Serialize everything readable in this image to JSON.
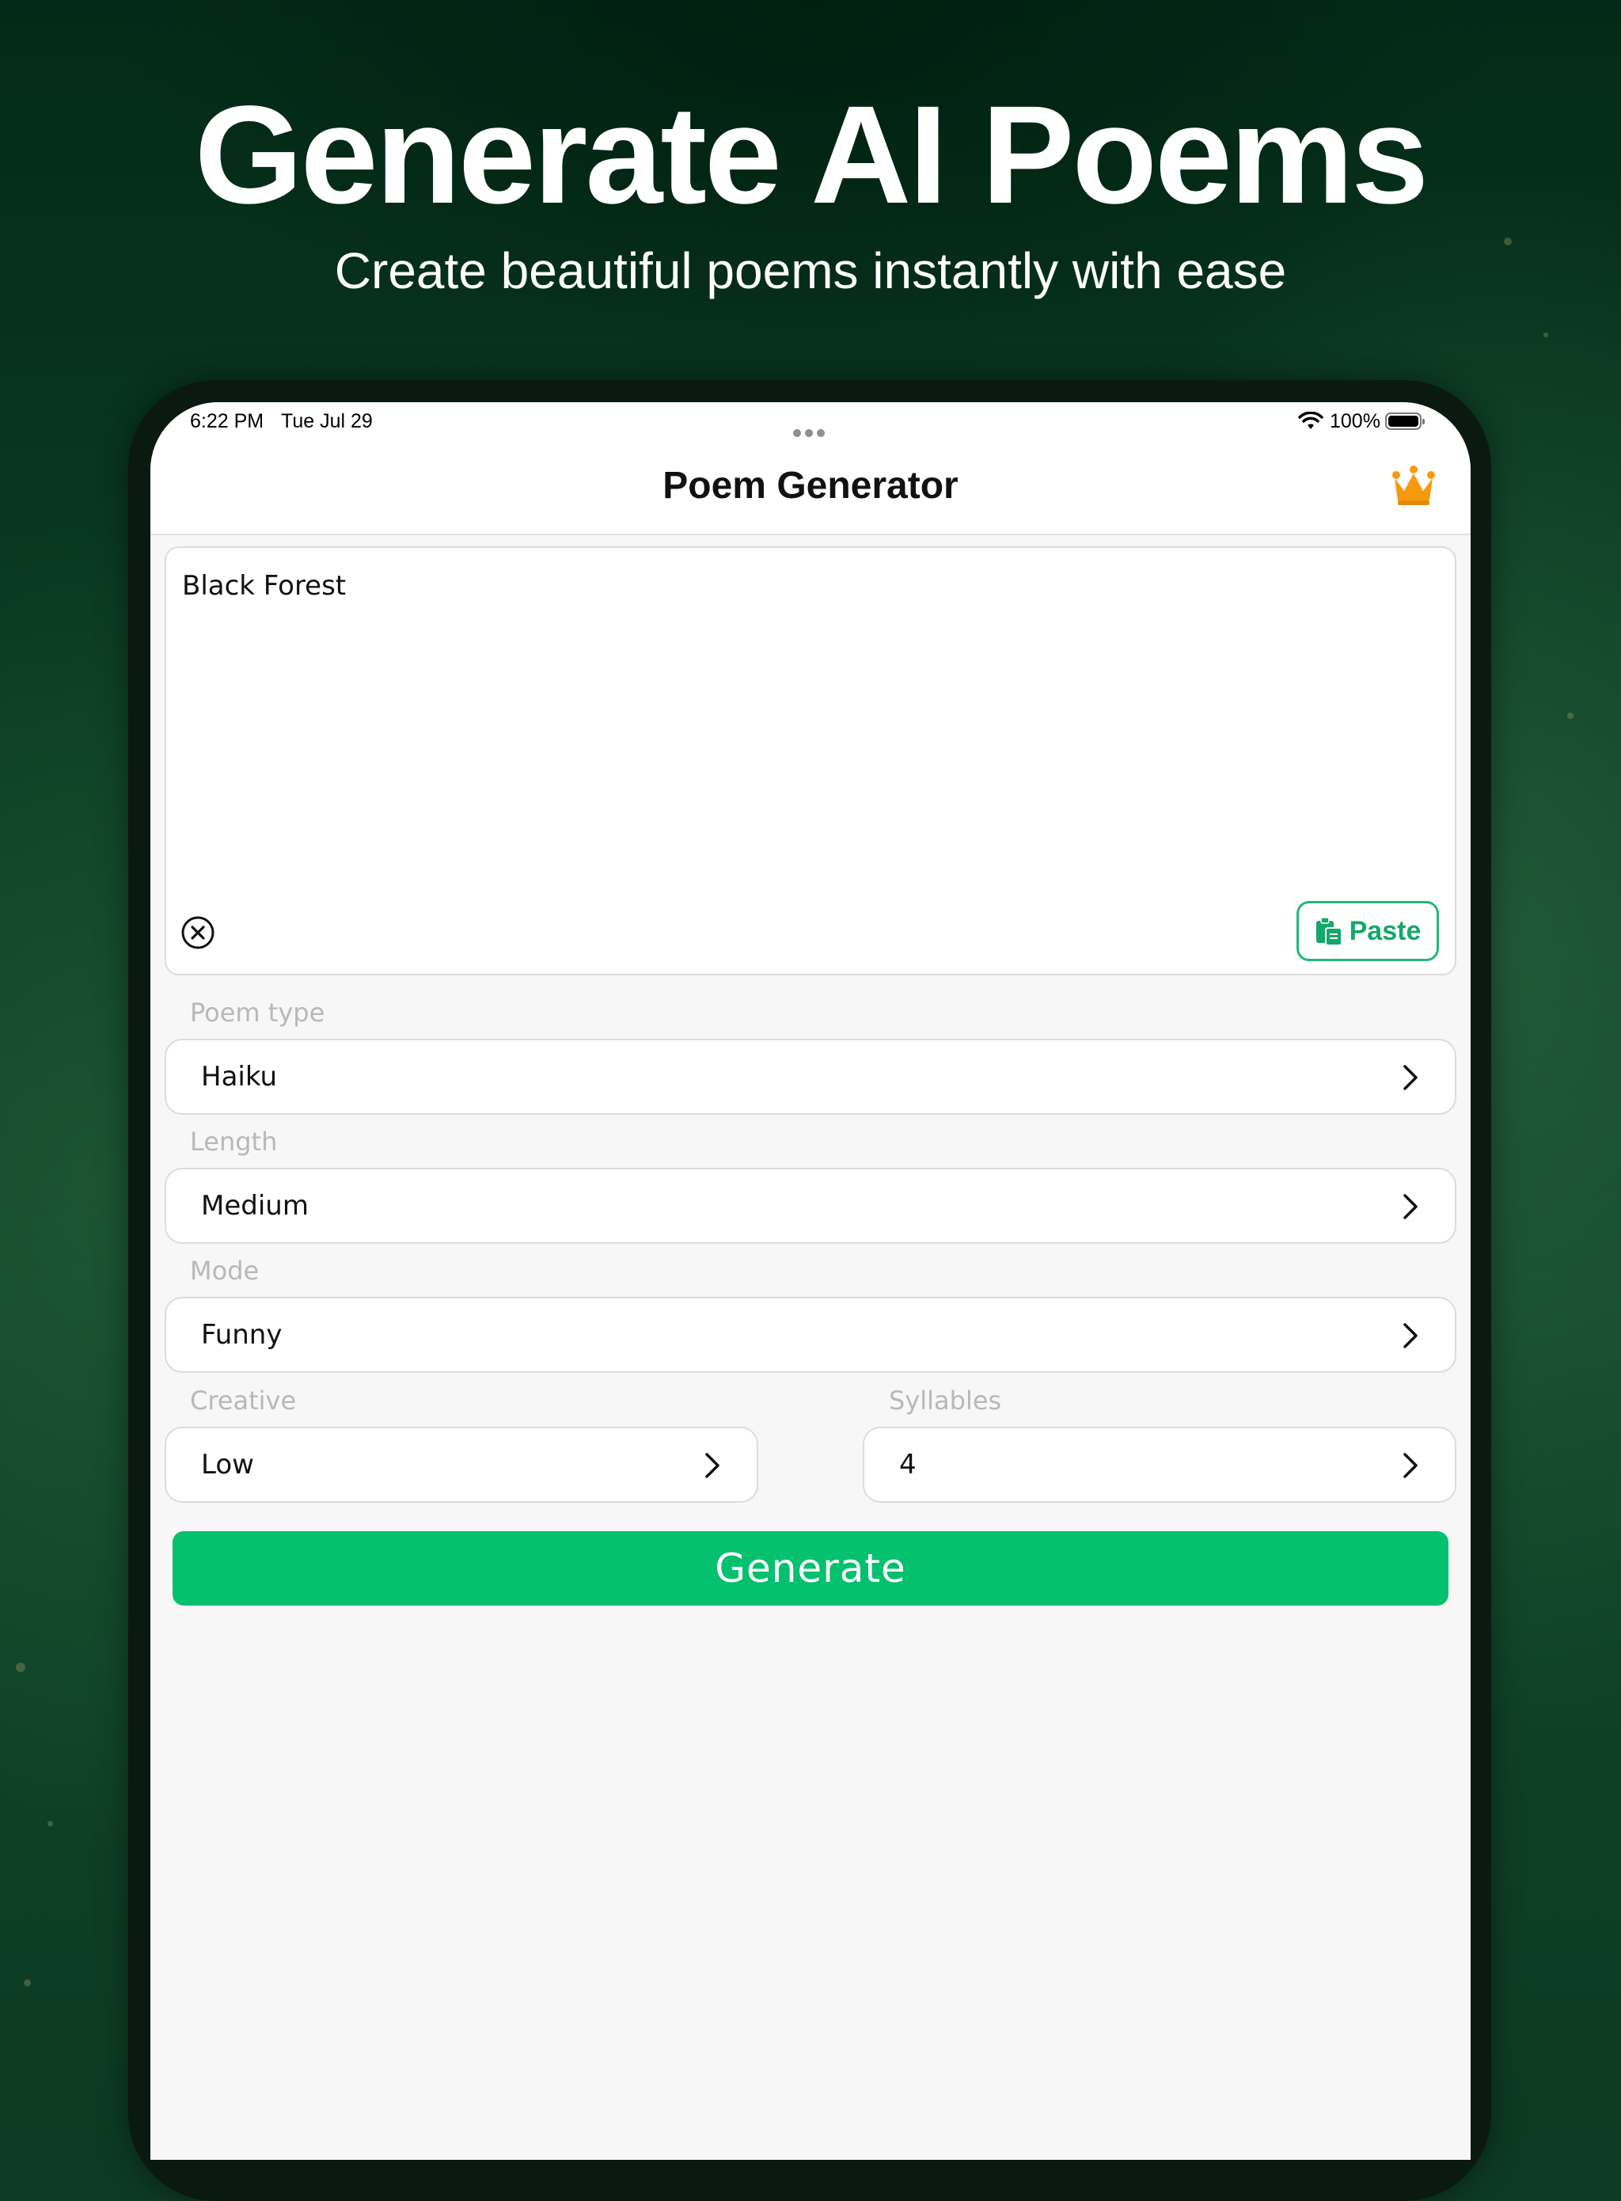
{
  "promo": {
    "headline": "Generate AI Poems",
    "subline": "Create beautiful poems instantly with ease"
  },
  "status_bar": {
    "time": "6:22 PM",
    "date": "Tue Jul 29",
    "battery_percent": "100%"
  },
  "nav": {
    "title": "Poem Generator",
    "premium_icon": "crown-icon"
  },
  "prompt": {
    "value": "Black Forest",
    "clear_icon": "clear-circle-icon",
    "paste_label": "Paste",
    "paste_icon": "clipboard-icon"
  },
  "options": {
    "poem_type": {
      "label": "Poem type",
      "value": "Haiku"
    },
    "length": {
      "label": "Length",
      "value": "Medium"
    },
    "mode": {
      "label": "Mode",
      "value": "Funny"
    },
    "creative": {
      "label": "Creative",
      "value": "Low"
    },
    "syllables": {
      "label": "Syllables",
      "value": "4"
    }
  },
  "actions": {
    "generate_label": "Generate"
  },
  "colors": {
    "accent": "#05c06e",
    "paste_accent": "#15a86a",
    "crown": "#f59a0c",
    "background_green": "#0b3d23"
  }
}
